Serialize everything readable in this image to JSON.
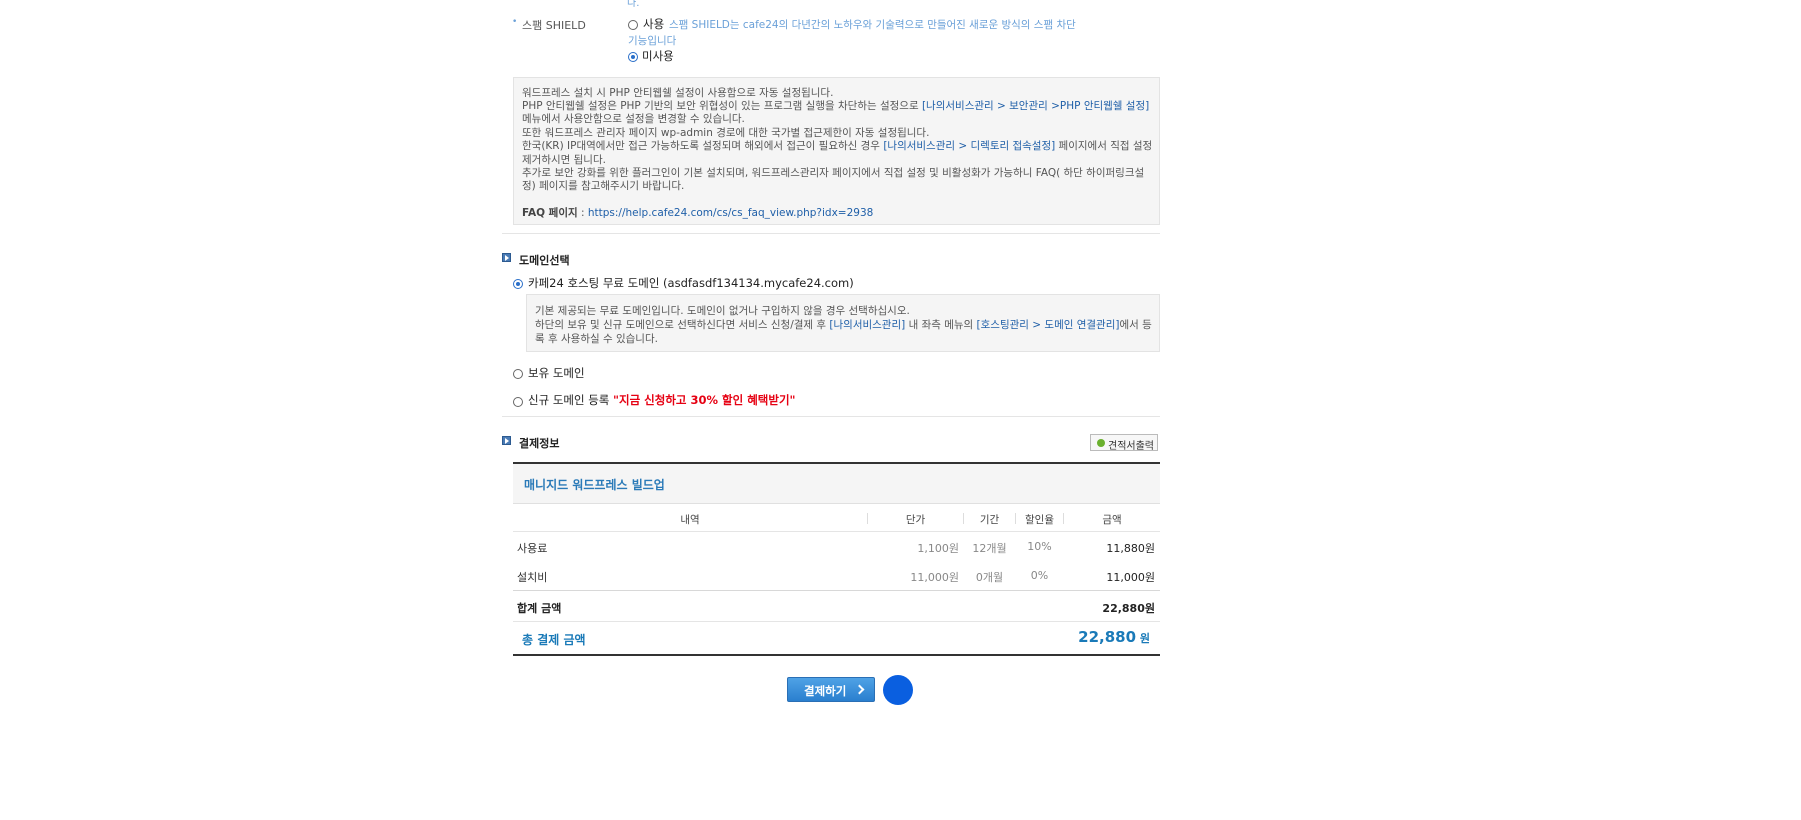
{
  "spam": {
    "top_fragment": "다.",
    "label": "스팸 SHIELD",
    "use_label": "사용",
    "use_desc_line1": "스팸 SHIELD는 cafe24의 다년간의 노하우와 기술력으로 만들어진 새로운 방식의 스팸 차단",
    "use_desc_line2": "기능입니다",
    "nouse_label": "미사용",
    "selected": "미사용"
  },
  "wp_notice": {
    "line1": "워드프레스 설치 시 PHP 안티웹쉘 설정이 사용함으로 자동 설정됩니다.",
    "line2_pre": "PHP 안티웹쉘 설정은 PHP 기반의 보안 위협성이 있는 프로그램 실행을 차단하는 설정으로 ",
    "line2_link": "[나의서비스관리 > 보안관리 >PHP 안티웹쉘 설정]",
    "line3": "메뉴에서 사용안함으로 설정을 변경할 수 있습니다.",
    "line4": "또한 워드프레스 관리자 페이지 wp-admin 경로에 대한 국가별 접근제한이 자동 설정됩니다.",
    "line5_pre": "한국(KR) IP대역에서만 접근 가능하도록 설정되며 해외에서 접근이 필요하신 경우 ",
    "line5_link": "[나의서비스관리 > 디렉토리 접속설정]",
    "line5_post": " 페이지에서 직접 설정",
    "line6": "제거하시면 됩니다.",
    "line7": "추가로 보안 강화를 위한 플러그인이 기본 설치되며, 워드프레스관리자 페이지에서 직접 설정 및 비활성화가 가능하니 FAQ( 하단 하이퍼링크설",
    "line8": "정) 페이지를 참고해주시기 바랍니다.",
    "faq_label": "FAQ 페이지",
    "faq_sep": " : ",
    "faq_url": "https://help.cafe24.com/cs/cs_faq_view.php?idx=2938"
  },
  "domain": {
    "section_title": "도메인선택",
    "option_free": "카페24 호스팅 무료 도메인 (asdfasdf134134.mycafe24.com)",
    "free_note_line1": "기본 제공되는 무료 도메인입니다. 도메인이 없거나 구입하지 않을 경우 선택하십시오.",
    "free_note_line2_pre": "하단의 보유 및 신규 도메인으로 선택하신다면 서비스 신청/결제 후 ",
    "free_note_line2_link1": "[나의서비스관리]",
    "free_note_line2_mid": " 내 좌측 메뉴의 ",
    "free_note_line2_link2": "[호스팅관리 > 도메인 연결관리]",
    "free_note_line2_post": "에서 등",
    "free_note_line3": "록 후 사용하실 수 있습니다.",
    "option_owned": "보유 도메인",
    "option_new": "신규 도메인 등록",
    "option_new_promo": "\"지금 신청하고 30% 할인 혜택받기\"",
    "selected": "free"
  },
  "payment": {
    "section_title": "결제정보",
    "estimate_button": "견적서출력",
    "product_title": "매니지드 워드프레스 빌드업",
    "headers": [
      "내역",
      "단가",
      "기간",
      "할인율",
      "금액"
    ],
    "rows": [
      {
        "item": "사용료",
        "unit_price": "1,100원",
        "period": "12개월",
        "discount": "10%",
        "amount": "11,880원"
      },
      {
        "item": "설치비",
        "unit_price": "11,000원",
        "period": "0개월",
        "discount": "0%",
        "amount": "11,000원"
      }
    ],
    "sum_label": "합계 금액",
    "sum_value": "22,880원",
    "total_label": "총 결제 금액",
    "total_value": "22,880",
    "total_unit": "원",
    "pay_button": "결제하기"
  },
  "colors": {
    "link": "#1f5fa8",
    "promo": "#e60012",
    "total": "#1a7ab8",
    "button": "#3b8fd9",
    "circle": "#0a5fe0"
  }
}
